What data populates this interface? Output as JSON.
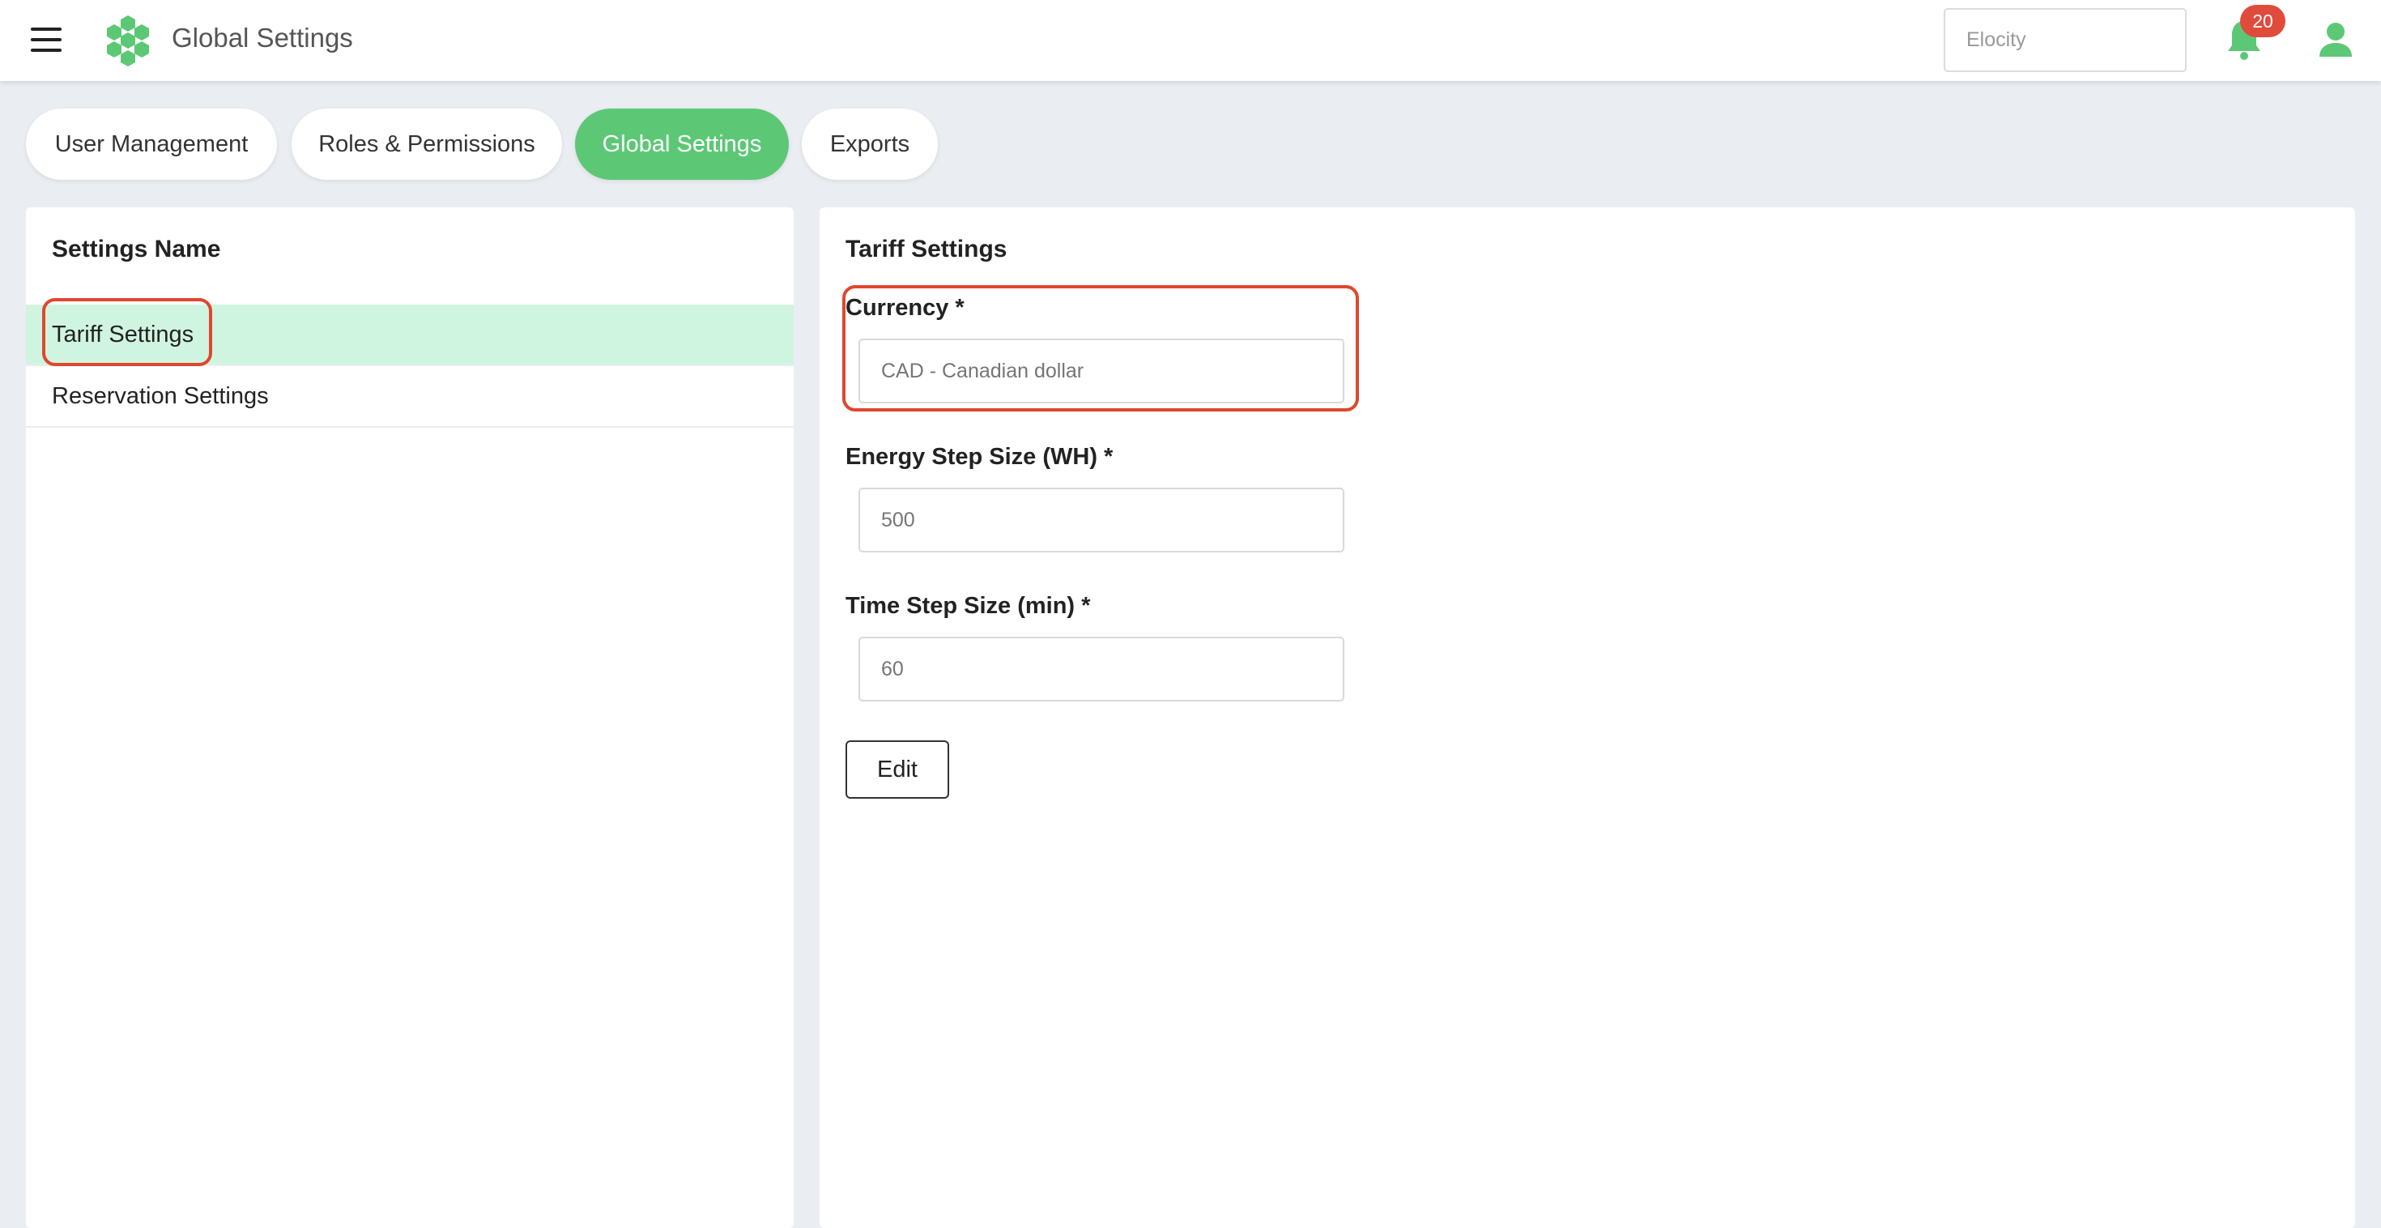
{
  "header": {
    "title": "Global Settings",
    "search": {
      "value": "",
      "placeholder": "Elocity"
    },
    "notifications": {
      "count": "20"
    },
    "brand_color": "#5cc876"
  },
  "tabs": [
    {
      "label": "User Management",
      "active": false
    },
    {
      "label": "Roles & Permissions",
      "active": false
    },
    {
      "label": "Global Settings",
      "active": true
    },
    {
      "label": "Exports",
      "active": false
    }
  ],
  "left_panel": {
    "heading": "Settings Name",
    "items": [
      {
        "label": "Tariff Settings",
        "selected": true
      },
      {
        "label": "Reservation Settings",
        "selected": false
      }
    ]
  },
  "right_panel": {
    "heading": "Tariff Settings",
    "fields": [
      {
        "label": "Currency *",
        "value": "",
        "placeholder": "CAD - Canadian dollar"
      },
      {
        "label": "Energy Step Size (WH) *",
        "value": "",
        "placeholder": "500"
      },
      {
        "label": "Time Step Size (min) *",
        "value": "",
        "placeholder": "60"
      }
    ],
    "edit_label": "Edit"
  },
  "colors": {
    "accent": "#5cc876",
    "selected_row": "#cff5e0",
    "highlight": "#e0462e",
    "badge": "#e04b3c"
  }
}
